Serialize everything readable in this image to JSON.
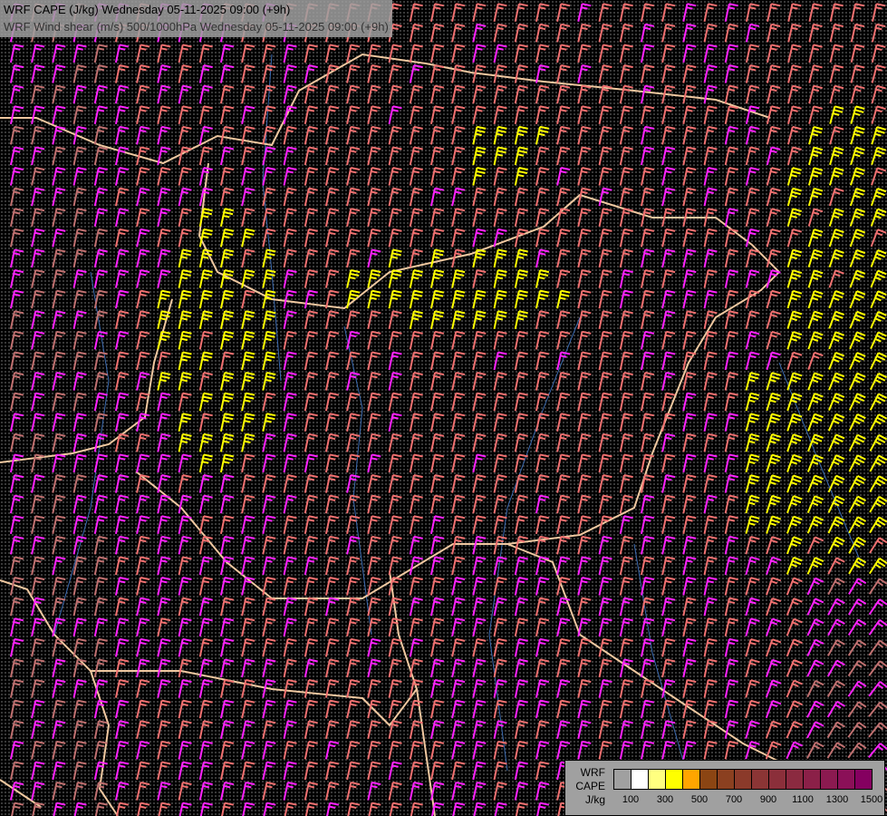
{
  "titles": {
    "cape": "WRF CAPE (J/kg) Wednesday 05-11-2025 09:00 (+9h)",
    "shear": "WRF Wind shear (m/s) 500/1000hPa Wednesday 05-11-2025 09:00 (+9h)"
  },
  "legend": {
    "label_line1": "WRF",
    "label_line2": "CAPE",
    "label_line3": "J/kg",
    "colors": [
      "#a0a0a0",
      "#ffffff",
      "#ffff80",
      "#ffff00",
      "#ffa500",
      "#8b4513",
      "#8b4020",
      "#8b3a2a",
      "#8b3535",
      "#8b2f3a",
      "#8b2a40",
      "#8b2048",
      "#8b1a50",
      "#8b1058",
      "#850060"
    ],
    "ticks": [
      "100",
      "300",
      "500",
      "700",
      "900",
      "1100",
      "1300",
      "1500"
    ]
  },
  "barb_colors": {
    "low": "#ff22ff",
    "mid": "#f07070",
    "brown": "#c07070",
    "high": "#ffff00",
    "border": "#f0c8a0",
    "river": "#3a6ab0"
  }
}
